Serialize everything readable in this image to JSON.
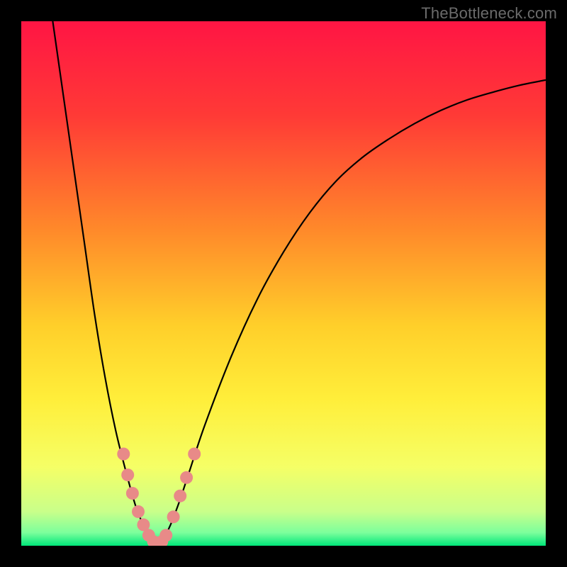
{
  "watermark": {
    "text": "TheBottleneck.com"
  },
  "chart_data": {
    "type": "line",
    "title": "",
    "xlabel": "",
    "ylabel": "",
    "xlim": [
      0,
      100
    ],
    "ylim": [
      0,
      100
    ],
    "grid": false,
    "legend": false,
    "gradient_stops": [
      {
        "offset": 0.0,
        "color": "#ff1544"
      },
      {
        "offset": 0.18,
        "color": "#ff3a36"
      },
      {
        "offset": 0.4,
        "color": "#ff8a2a"
      },
      {
        "offset": 0.58,
        "color": "#ffcf2a"
      },
      {
        "offset": 0.72,
        "color": "#ffee3a"
      },
      {
        "offset": 0.85,
        "color": "#f5ff66"
      },
      {
        "offset": 0.935,
        "color": "#c9ff8a"
      },
      {
        "offset": 0.975,
        "color": "#7cff9c"
      },
      {
        "offset": 1.0,
        "color": "#00e77a"
      }
    ],
    "series": [
      {
        "name": "left-curve",
        "type": "line",
        "color": "#000000",
        "points": [
          {
            "x": 6.0,
            "y": 100.0
          },
          {
            "x": 8.0,
            "y": 86.0
          },
          {
            "x": 10.0,
            "y": 72.0
          },
          {
            "x": 12.0,
            "y": 58.0
          },
          {
            "x": 14.0,
            "y": 44.0
          },
          {
            "x": 16.0,
            "y": 32.0
          },
          {
            "x": 18.0,
            "y": 22.0
          },
          {
            "x": 20.0,
            "y": 14.0
          },
          {
            "x": 22.0,
            "y": 7.0
          },
          {
            "x": 24.0,
            "y": 2.5
          },
          {
            "x": 25.0,
            "y": 1.0
          },
          {
            "x": 26.0,
            "y": 0.3
          }
        ]
      },
      {
        "name": "right-curve",
        "type": "line",
        "color": "#000000",
        "points": [
          {
            "x": 26.0,
            "y": 0.3
          },
          {
            "x": 28.0,
            "y": 3.0
          },
          {
            "x": 30.0,
            "y": 8.0
          },
          {
            "x": 32.0,
            "y": 14.0
          },
          {
            "x": 35.0,
            "y": 23.0
          },
          {
            "x": 40.0,
            "y": 36.0
          },
          {
            "x": 45.0,
            "y": 47.0
          },
          {
            "x": 50.0,
            "y": 56.0
          },
          {
            "x": 55.0,
            "y": 63.5
          },
          {
            "x": 60.0,
            "y": 69.5
          },
          {
            "x": 65.0,
            "y": 74.0
          },
          {
            "x": 70.0,
            "y": 77.5
          },
          {
            "x": 75.0,
            "y": 80.5
          },
          {
            "x": 80.0,
            "y": 83.0
          },
          {
            "x": 85.0,
            "y": 85.0
          },
          {
            "x": 90.0,
            "y": 86.5
          },
          {
            "x": 95.0,
            "y": 87.8
          },
          {
            "x": 100.0,
            "y": 88.8
          }
        ]
      },
      {
        "name": "markers",
        "type": "scatter",
        "color": "#e88a88",
        "radius": 9,
        "points": [
          {
            "x": 19.5,
            "y": 17.5
          },
          {
            "x": 20.3,
            "y": 13.5
          },
          {
            "x": 21.2,
            "y": 10.0
          },
          {
            "x": 22.3,
            "y": 6.5
          },
          {
            "x": 23.3,
            "y": 4.0
          },
          {
            "x": 24.3,
            "y": 2.0
          },
          {
            "x": 25.2,
            "y": 0.8
          },
          {
            "x": 26.0,
            "y": 0.3
          },
          {
            "x": 26.8,
            "y": 0.8
          },
          {
            "x": 27.6,
            "y": 2.0
          },
          {
            "x": 29.0,
            "y": 5.5
          },
          {
            "x": 30.3,
            "y": 9.5
          },
          {
            "x": 31.5,
            "y": 13.0
          },
          {
            "x": 33.0,
            "y": 17.5
          }
        ]
      }
    ]
  }
}
